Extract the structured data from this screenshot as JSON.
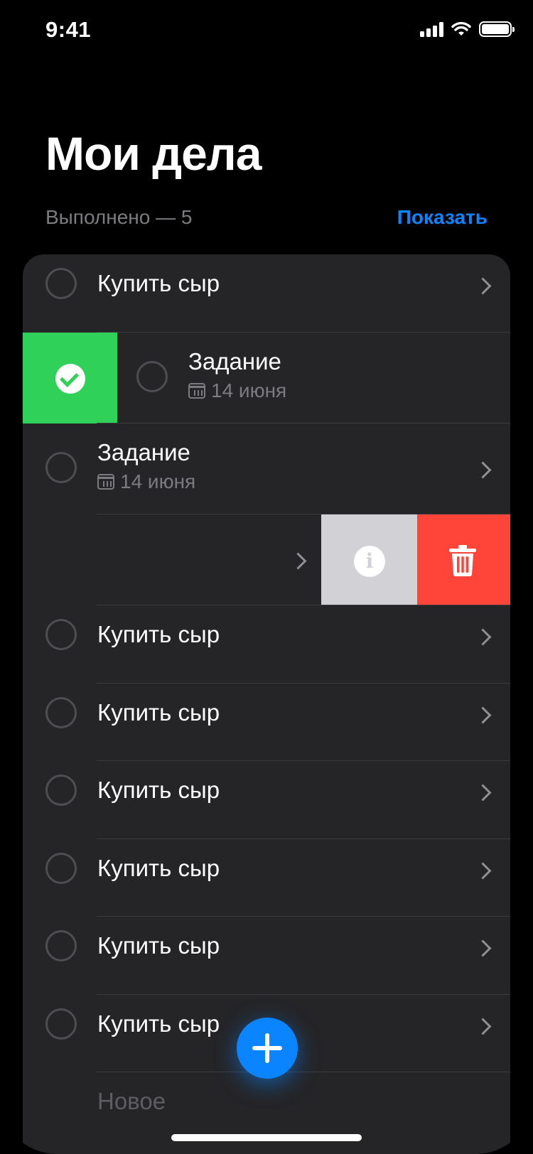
{
  "status": {
    "time": "9:41"
  },
  "header": {
    "title": "Мои дела",
    "done_label": "Выполнено — 5",
    "show_label": "Показать"
  },
  "tasks": [
    {
      "label": "Купить сыр"
    },
    {
      "label": "Задание",
      "date": "14 июня",
      "state": "swiped-right"
    },
    {
      "label": "Задание",
      "date": "14 июня"
    },
    {
      "state": "swiped-left"
    },
    {
      "label": "Купить сыр"
    },
    {
      "label": "Купить сыр"
    },
    {
      "label": "Купить сыр"
    },
    {
      "label": "Купить сыр"
    },
    {
      "label": "Купить сыр"
    },
    {
      "label": "Купить сыр"
    }
  ],
  "new_item": {
    "placeholder": "Новое"
  },
  "icons": {
    "chevron": "chevron-right-icon",
    "calendar": "calendar-icon",
    "complete": "checkmark-circle-icon",
    "info": "info-icon",
    "delete": "trash-icon",
    "add": "plus-icon"
  },
  "colors": {
    "accent": "#0a84ff",
    "complete": "#30d158",
    "delete": "#ff453a",
    "info": "#d1d1d6",
    "card": "#252528"
  }
}
